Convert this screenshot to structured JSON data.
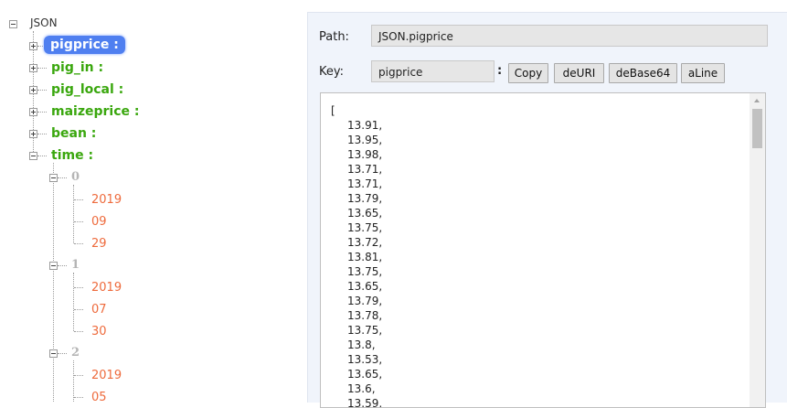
{
  "tree": {
    "root_label": "JSON",
    "keys": [
      {
        "label": "pigprice :",
        "selected": true,
        "expanded": false
      },
      {
        "label": "pig_in :",
        "selected": false,
        "expanded": false
      },
      {
        "label": "pig_local :",
        "selected": false,
        "expanded": false
      },
      {
        "label": "maizeprice :",
        "selected": false,
        "expanded": false
      },
      {
        "label": "bean :",
        "selected": false,
        "expanded": false
      },
      {
        "label": "time :",
        "selected": false,
        "expanded": true
      }
    ],
    "time_children": [
      {
        "index": "0",
        "values": [
          "2019",
          "09",
          "29"
        ]
      },
      {
        "index": "1",
        "values": [
          "2019",
          "07",
          "30"
        ]
      },
      {
        "index": "2",
        "values": [
          "2019",
          "05"
        ]
      }
    ]
  },
  "panel": {
    "path_label": "Path:",
    "path_value": "JSON.pigprice",
    "key_label": "Key:",
    "key_value": "pigprice",
    "colon": ":",
    "buttons": {
      "copy": "Copy",
      "deuri": "deURI",
      "debase64": "deBase64",
      "aline": "aLine"
    },
    "content_lines": [
      "[",
      "13.91,",
      "13.95,",
      "13.98,",
      "13.71,",
      "13.71,",
      "13.79,",
      "13.65,",
      "13.75,",
      "13.72,",
      "13.81,",
      "13.75,",
      "13.65,",
      "13.79,",
      "13.78,",
      "13.75,",
      "13.8,",
      "13.53,",
      "13.65,",
      "13.6,",
      "13.59,"
    ]
  },
  "colors": {
    "key_green": "#3aa70e",
    "selected_blue": "#4f7ff0",
    "value_orange": "#ee6b3d",
    "index_gray": "#b5b5b5"
  }
}
